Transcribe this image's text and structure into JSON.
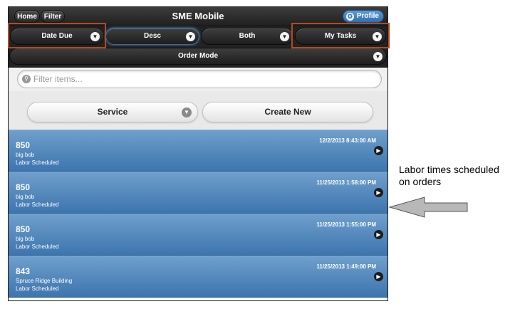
{
  "header": {
    "title": "SME Mobile",
    "home_label": "Home",
    "filter_label": "Filter",
    "profile_label": "Profile",
    "profile_icon": "gear-icon"
  },
  "selects": {
    "sort_field": "Date Due",
    "sort_order": "Desc",
    "scope": "Both",
    "tasks": "My Tasks",
    "mode": "Order Mode"
  },
  "search": {
    "placeholder": "Filter items..."
  },
  "buttons": {
    "service": "Service",
    "create_new": "Create New"
  },
  "orders": [
    {
      "number": "850",
      "name": "big bob",
      "status": "Labor Scheduled",
      "date": "12/2/2013 8:43:00 AM"
    },
    {
      "number": "850",
      "name": "big bob",
      "status": "Labor Scheduled",
      "date": "11/25/2013 1:58:00 PM"
    },
    {
      "number": "850",
      "name": "big bob",
      "status": "Labor Scheduled",
      "date": "11/25/2013 1:55:00 PM"
    },
    {
      "number": "843",
      "name": "Spruce Ridge Building",
      "status": "Labor Scheduled",
      "date": "11/25/2013 1:49:00 PM"
    }
  ],
  "annotation": {
    "text": "Labor times scheduled on orders"
  },
  "colors": {
    "highlight": "#b34a1e",
    "list_item": "#4f86bd",
    "profile": "#3f82c4"
  }
}
